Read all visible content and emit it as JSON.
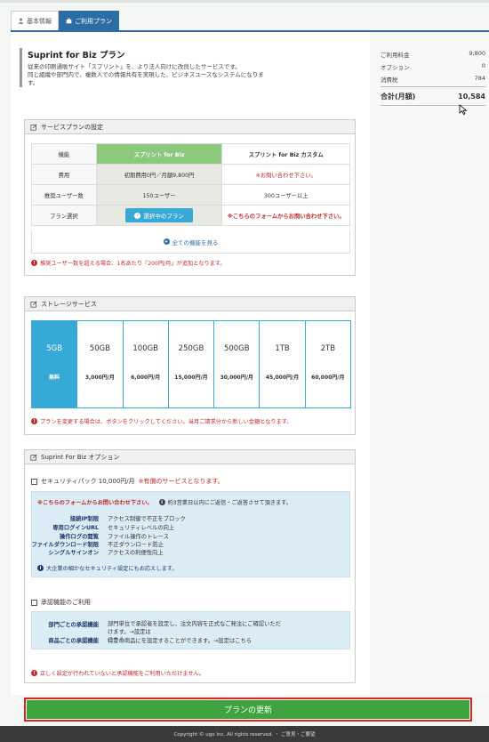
{
  "tabs": [
    {
      "label": "基本情報",
      "icon": "user-icon"
    },
    {
      "label": "ご利用プラン",
      "icon": "briefcase-icon"
    }
  ],
  "intro": {
    "title": "Suprint for Biz プラン",
    "line1": "従来の印刷通販サイト「スプリント」を、より法人向けに改良したサービスです。",
    "line2": "同じ組織や部門内で、複数人での情報共有を実現した、ビジネスユースなシステムになりま",
    "line3": "す。"
  },
  "summary": {
    "rows": [
      {
        "label": "ご利用料金",
        "value": "9,800"
      },
      {
        "label": "オプション",
        "value": "0"
      },
      {
        "label": "消費税",
        "value": "784"
      }
    ],
    "total_label": "合計(月額)",
    "total_value": "10,584"
  },
  "plan": {
    "heading": "サービスプランの設定",
    "col_feature": "機能",
    "col_biz": "スプリント for Biz",
    "col_custom": "スプリント for Biz カスタム",
    "rows": [
      {
        "label": "費用",
        "biz": "初期費用0円／月額9,800円",
        "custom": "※お問い合わせ下さい。"
      },
      {
        "label": "推奨ユーザー数",
        "biz": "150ユーザー",
        "custom": "300ユーザー以上"
      }
    ],
    "select_label": "プラン選択",
    "select_button": "選択中のプラン",
    "custom_contact": "※こちらのフォームからお問い合わせ下さい。",
    "all_features": "全ての機能を見る",
    "note": "推奨ユーザー数を超える場合、1名あたり『200円/月』が追加となります。"
  },
  "storage": {
    "heading": "ストレージサービス",
    "options": [
      {
        "capacity": "5GB",
        "price": "無料"
      },
      {
        "capacity": "50GB",
        "price": "3,000円/月"
      },
      {
        "capacity": "100GB",
        "price": "6,000円/月"
      },
      {
        "capacity": "250GB",
        "price": "15,000円/月"
      },
      {
        "capacity": "500GB",
        "price": "30,000円/月"
      },
      {
        "capacity": "1TB",
        "price": "45,000円/月"
      },
      {
        "capacity": "2TB",
        "price": "60,000円/月"
      }
    ],
    "note": "プランを変更する場合は、ボタンをクリックしてください。当月ご請求分から新しい金額となります。"
  },
  "options": {
    "heading": "Suprint For Biz オプション",
    "security_label": "セキュリティパック 10,000円/月",
    "security_paid": "※有償のサービスとなります。",
    "contact_link": "※こちらのフォームからお問い合わせ下さい。",
    "contact_reply": "約3営業日以内にご返信・ご返答させて頂きます。",
    "features": [
      {
        "k": "接続IP制限",
        "v": "アクセス制御で不正をブロック"
      },
      {
        "k": "専用ログインURL",
        "v": "セキュリティレベルの向上"
      },
      {
        "k": "操作ログの閲覧",
        "v": "ファイル操作のトレース"
      },
      {
        "k": "ファイルダウンロード制限",
        "v": "不正ダウンロード防止"
      },
      {
        "k": "シングルサインオン",
        "v": "アクセスの利便性向上"
      }
    ],
    "enterprise_note": "大企業の細かなセキュリティ設定にもお応えします。",
    "approval_label": "承認機能のご利用",
    "approval_rows": [
      {
        "k": "部門ごとの承認機能",
        "v1": "部門単位で承認者を設定し、注文内容を正式なご発注にご確認いただけます。→設定は",
        "v2": "こちら"
      },
      {
        "k": "商品ごとの承認機能",
        "v1": "特定の商品にを設定することができます。→設定はこちら",
        "v2": ""
      }
    ],
    "warning": "正しく設定が行われていないと承認機能をご利用いただけません。"
  },
  "update_button": "プランの更新",
  "footer": "Copyright © ugo Inc. All rights reserved. ・ ご意見・ご要望",
  "colors": {
    "accent": "#2e6da4",
    "green": "#3fa43f",
    "storage_blue": "#36a9d6",
    "alert_red": "#c62828"
  }
}
